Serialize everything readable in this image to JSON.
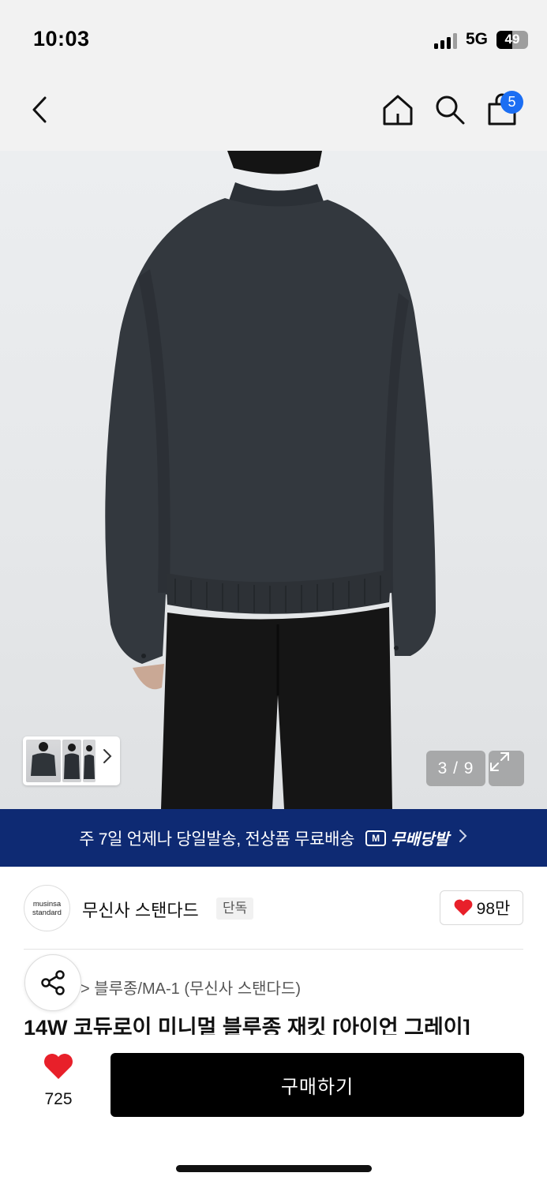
{
  "status_bar": {
    "time": "10:03",
    "network": "5G",
    "battery_level": "49",
    "battery_fraction": 0.49
  },
  "nav": {
    "back_icon": "chevron-left-icon",
    "home_icon": "home-icon",
    "search_icon": "search-icon",
    "cart_icon": "shopping-bag-icon",
    "cart_badge": "5"
  },
  "gallery": {
    "counter": "3 / 9",
    "current": 3,
    "total": 9,
    "expand_icon": "expand-icon",
    "thumb_more_icon": "chevron-right-icon"
  },
  "banner": {
    "text": "주 7일 언제나 당일발송, 전상품 무료배송",
    "logo_text": "무배당발",
    "logo_mark": "M",
    "background": "#0e2a73"
  },
  "brand": {
    "logo_line1": "musinsa",
    "logo_line2": "standard",
    "name": "무신사 스탠다드",
    "badge": "단독",
    "likes": "98만"
  },
  "product": {
    "breadcrumb": "> 블루종/MA-1 (무신사 스탠다드)",
    "title": "14W 코듀로이 미니멀 블루종 재킷 [아이언 그레이]"
  },
  "bottom_bar": {
    "wish_count": "725",
    "buy_label": "구매하기",
    "accent": "#e8202a"
  }
}
